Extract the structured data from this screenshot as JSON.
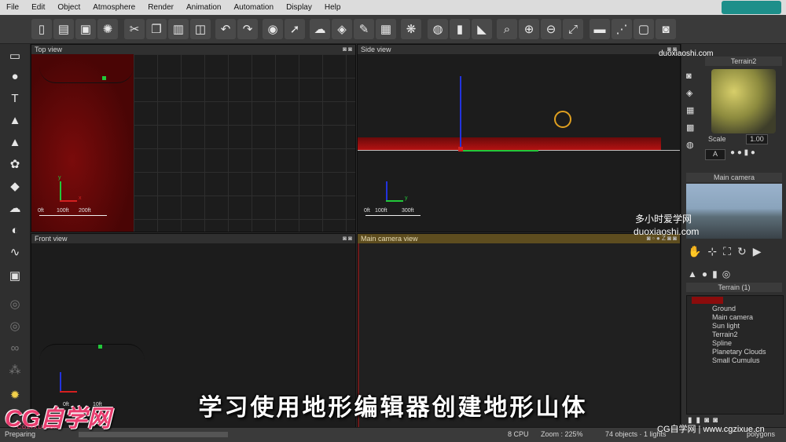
{
  "menu": [
    "File",
    "Edit",
    "Object",
    "Atmosphere",
    "Render",
    "Animation",
    "Automation",
    "Display",
    "Help"
  ],
  "toolbar_icons": [
    "new-icon",
    "open-icon",
    "save-icon",
    "render-icon",
    "cut-icon",
    "copy-icon",
    "paste-icon",
    "duplicate-icon",
    "undo-icon",
    "redo-icon",
    "select-icon",
    "move-icon",
    "atmosphere-icon",
    "material-icon",
    "edit-icon",
    "graph-icon",
    "palette-icon",
    "render-preview-icon",
    "bars-icon",
    "flip-icon",
    "zoom-icon",
    "zoom-in-icon",
    "zoom-out-icon",
    "fit-icon",
    "film-icon",
    "timeline-icon",
    "frame-icon",
    "camera-icon"
  ],
  "viewports": {
    "top": {
      "title": "Top view",
      "scale": [
        "0ft",
        "100ft",
        "200ft"
      ],
      "axis_x": "x",
      "axis_y": "y"
    },
    "side": {
      "title": "Side view",
      "scale": [
        "0ft",
        "100ft",
        "300ft"
      ],
      "axis_x": "y",
      "axis_y": "z"
    },
    "front": {
      "title": "Front view",
      "scale": [
        "0ft",
        "10ft"
      ]
    },
    "camera": {
      "title": "Main camera view"
    }
  },
  "right_panel": {
    "material_title": "Terrain2",
    "scale_label": "Scale",
    "scale_value": "1.00",
    "letter_button": "A",
    "camera_title": "Main camera",
    "tree_title": "Terrain (1)",
    "tree_items": [
      "Ground",
      "Main camera",
      "Sun light",
      "Terrain2",
      "Spline",
      "Planetary Clouds",
      "Small Cumulus"
    ],
    "bottom_label": "Planetary"
  },
  "status": {
    "left": "Preparing",
    "cpu": "8 CPU",
    "zoom": "Zoom : 225%",
    "objects": "74 objects · 1 lights",
    "polygons": "polygons"
  },
  "overlay": {
    "subtitle": "学习使用地形编辑器创建地形山体",
    "logo": "CG自学网",
    "logo_sub": "CGZIXUE.CN",
    "watermark_cn": "多小时爱学网",
    "watermark_url": "duoxiaoshi.com",
    "watermark_top": "duoxiaoshi.com",
    "footer_brand": "CG自学网 | www.cgzixue.cn"
  }
}
